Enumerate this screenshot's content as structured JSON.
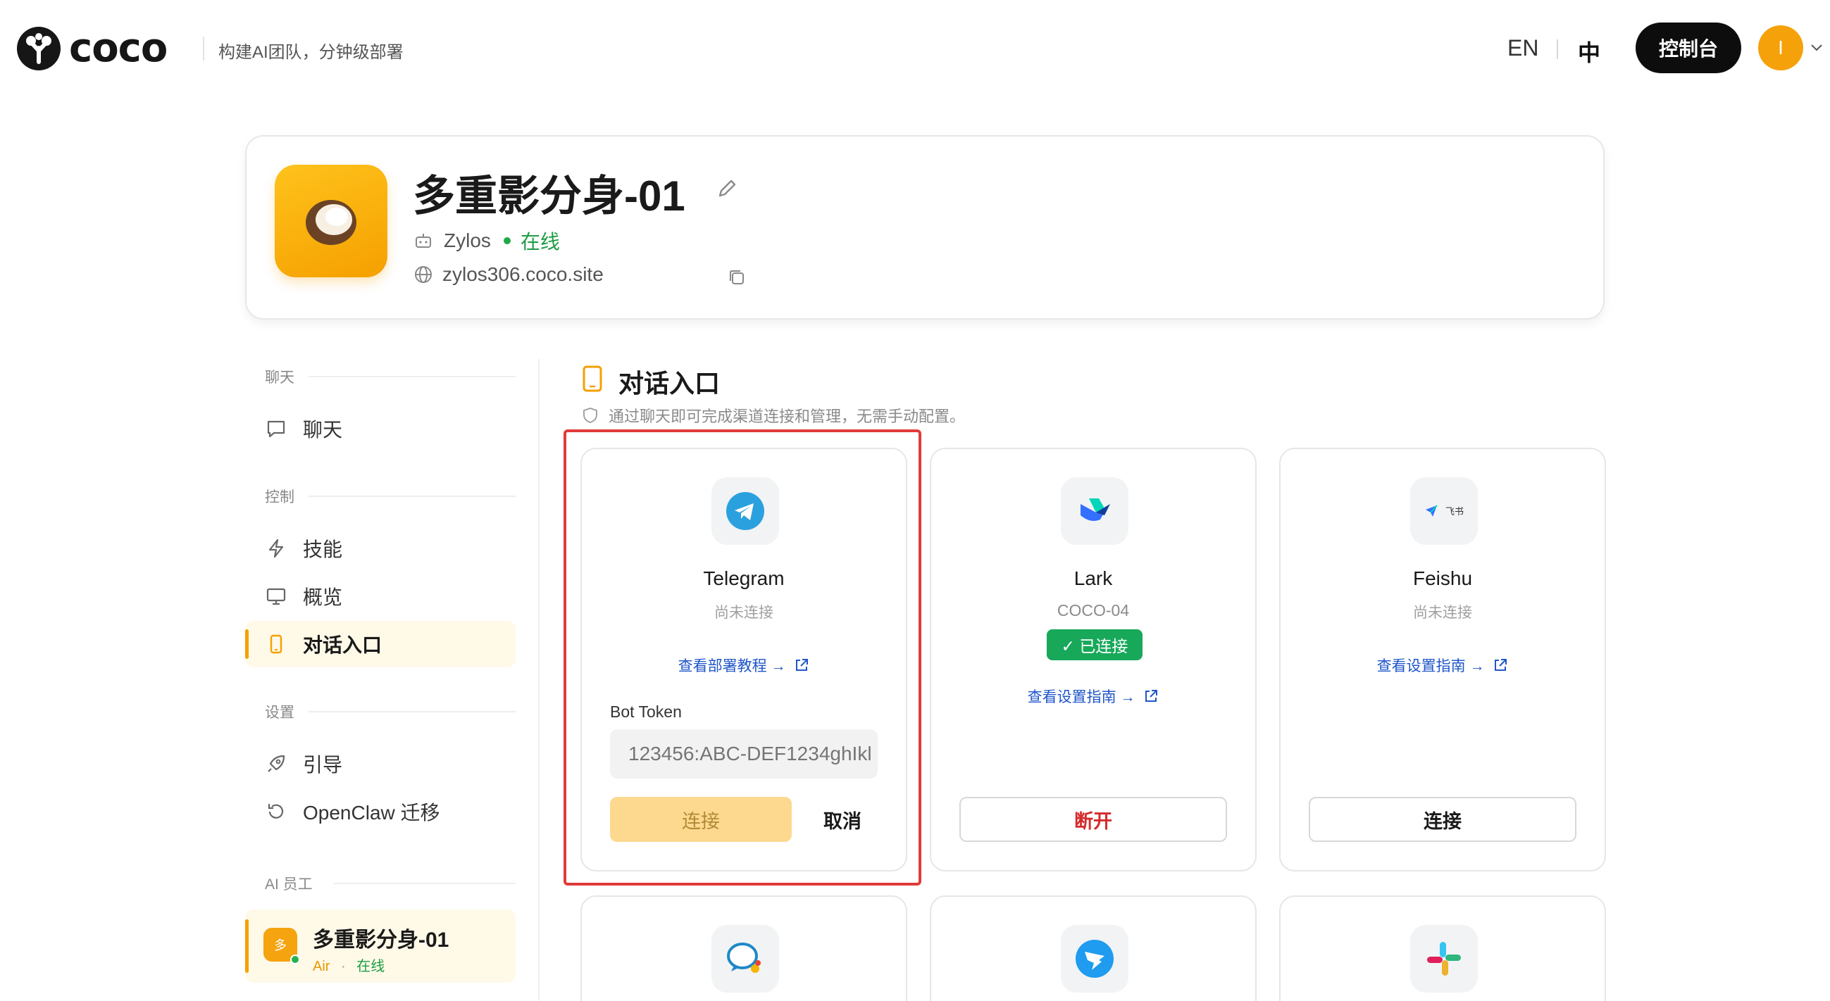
{
  "brand": {
    "logo_text": "coco",
    "tagline": "构建AI团队，分钟级部署"
  },
  "header": {
    "lang_en": "EN",
    "lang_zh": "中",
    "console_label": "控制台",
    "avatar_initial": "I"
  },
  "agent": {
    "name": "多重影分身-01",
    "owner": "Zylos",
    "status": "在线",
    "domain": "zylos306.coco.site"
  },
  "sidebar": {
    "sections": [
      {
        "title": "聊天",
        "items": [
          {
            "label": "聊天",
            "icon": "chat-icon"
          }
        ]
      },
      {
        "title": "控制",
        "items": [
          {
            "label": "技能",
            "icon": "bolt-icon"
          },
          {
            "label": "概览",
            "icon": "monitor-icon"
          },
          {
            "label": "对话入口",
            "icon": "phone-icon",
            "active": true
          }
        ]
      },
      {
        "title": "设置",
        "items": [
          {
            "label": "引导",
            "icon": "rocket-icon"
          },
          {
            "label": "OpenClaw 迁移",
            "icon": "refresh-icon"
          }
        ]
      },
      {
        "title": "AI 员工",
        "items": []
      }
    ],
    "agent_item": {
      "icon_char": "多",
      "name": "多重影分身-01",
      "plan": "Air",
      "sep": "·",
      "status": "在线"
    }
  },
  "main": {
    "title": "对话入口",
    "subtitle": "通过聊天即可完成渠道连接和管理，无需手动配置。",
    "channels": [
      {
        "name": "Telegram",
        "status": "尚未连接",
        "link": "查看部署教程 →",
        "token_label": "Bot Token",
        "token_placeholder": "123456:ABC-DEF1234ghIkl",
        "connect_label": "连接",
        "cancel_label": "取消"
      },
      {
        "name": "Lark",
        "status": "COCO-04",
        "badge": "✓ 已连接",
        "link": "查看设置指南 →",
        "button": "断开"
      },
      {
        "name": "Feishu",
        "status": "尚未连接",
        "link": "查看设置指南 →",
        "button": "连接",
        "icon_text": "飞书"
      }
    ]
  },
  "colors": {
    "accent": "#f5a000",
    "success": "#17a85a",
    "danger": "#d52a2a",
    "link": "#1f56c9",
    "highlight": "#e23a3a"
  }
}
